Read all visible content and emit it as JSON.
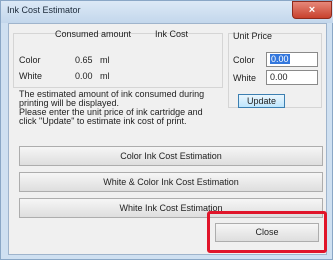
{
  "window": {
    "title": "Ink Cost Estimator",
    "close_glyph": "×"
  },
  "headers": {
    "consumed": "Consumed amount",
    "ink_cost": "Ink Cost",
    "unit_price": "Unit Price"
  },
  "rows": [
    {
      "label": "Color",
      "amount": "0.65",
      "unit": "ml"
    },
    {
      "label": "White",
      "amount": "0.00",
      "unit": "ml"
    }
  ],
  "unit_price": {
    "color_label": "Color",
    "color_value": "0.00",
    "white_label": "White",
    "white_value": "0.00"
  },
  "buttons": {
    "update": "Update",
    "color_est": "Color Ink Cost Estimation",
    "white_color_est": "White & Color Ink Cost Estimation",
    "white_est": "White Ink Cost Estimation",
    "close": "Close"
  },
  "note": {
    "line1": "The estimated amount of ink consumed during",
    "line2": "printing will be displayed.",
    "line3": "Please enter the unit price of ink cartridge and",
    "line4": "click \"Update\" to estimate ink cost of print."
  },
  "colors": {
    "highlight": "#e0152a",
    "titlebar_close": "#c8412d"
  }
}
